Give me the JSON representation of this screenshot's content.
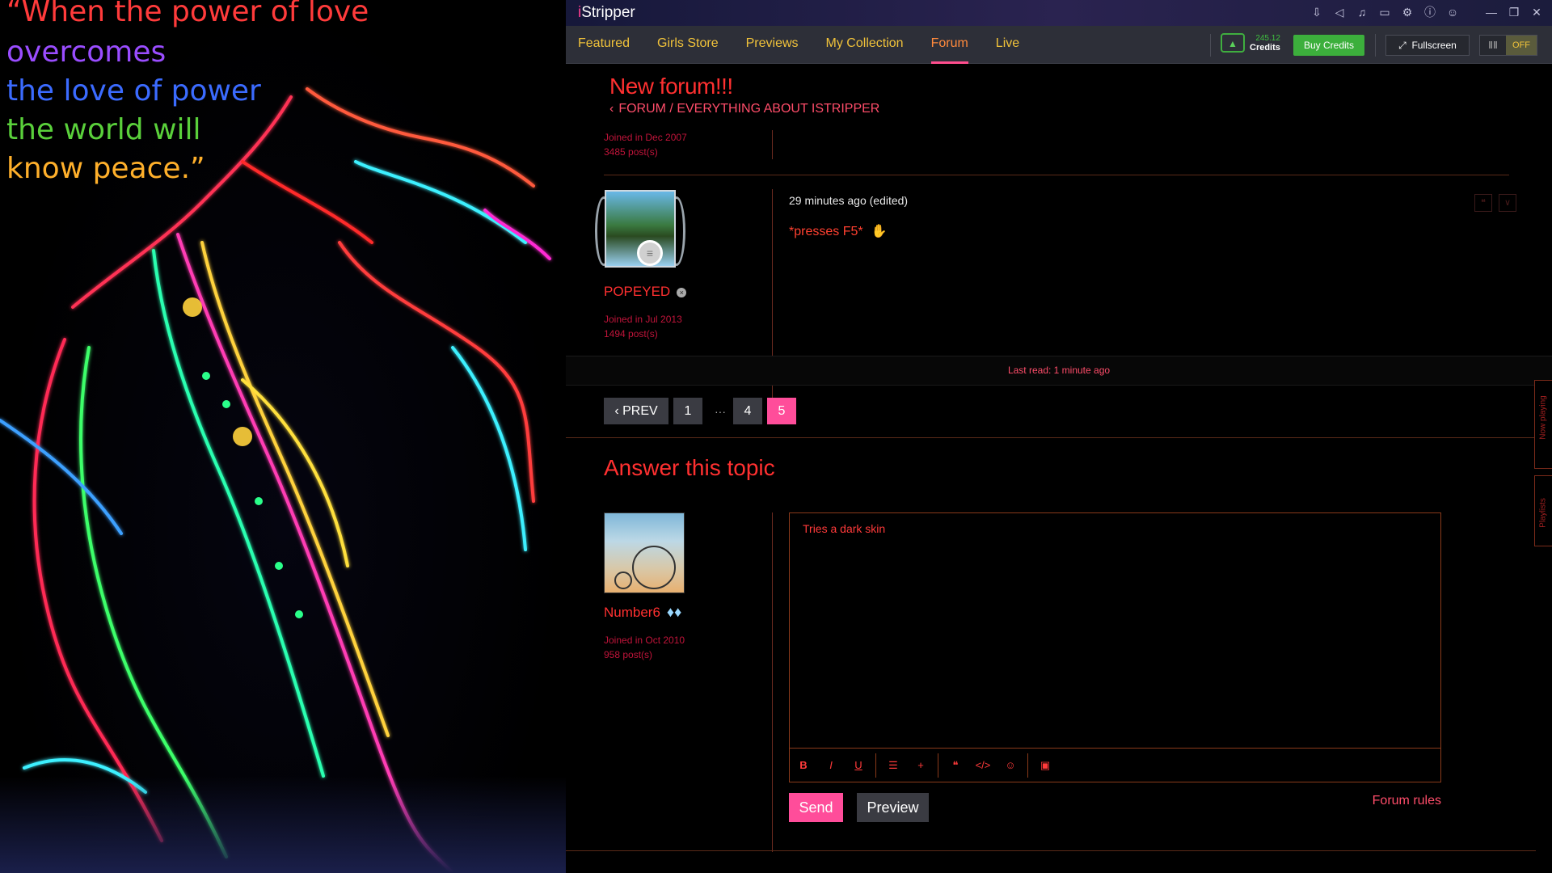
{
  "wallpaper": {
    "quote_lines": [
      {
        "text": "“When the power of love",
        "color": "#ff3b3b"
      },
      {
        "text": "overcomes",
        "color": "#9a4dff"
      },
      {
        "text": "the love of power",
        "color": "#3b6bff"
      },
      {
        "text": "the world will",
        "color": "#5ad03b"
      },
      {
        "text": "know peace.”",
        "color": "#ffb02b"
      }
    ]
  },
  "app": {
    "title_brand": "i",
    "title_rest": "Stripper",
    "window_icons": [
      "download-icon",
      "megaphone-icon",
      "music-icon",
      "monitor-icon",
      "gear-icon",
      "info-icon",
      "user-icon"
    ],
    "window_controls": [
      "minimize-icon",
      "restore-icon",
      "close-icon"
    ]
  },
  "nav": {
    "items": [
      {
        "label": "Featured"
      },
      {
        "label": "Girls Store"
      },
      {
        "label": "Previews"
      },
      {
        "label": "My Collection"
      },
      {
        "label": "Forum"
      },
      {
        "label": "Live"
      }
    ],
    "active": "Forum",
    "credits_amount": "245.12",
    "credits_label": "Credits",
    "buy_credits": "Buy Credits",
    "fullscreen": "Fullscreen",
    "toggle_state": "OFF"
  },
  "topic": {
    "title": "New forum!!!",
    "breadcrumb": "FORUM / EVERYTHING ABOUT ISTRIPPER"
  },
  "prev_post_meta": {
    "joined": "Joined in Dec 2007",
    "posts": "3485 post(s)"
  },
  "post": {
    "username": "POPEYED",
    "joined": "Joined in Jul 2013",
    "posts": "1494 post(s)",
    "time": "29 minutes ago (edited)",
    "body": "*presses F5*"
  },
  "last_read": "Last read: 1 minute ago",
  "pagination": {
    "prev": "PREV",
    "pages": [
      "1",
      "4",
      "5"
    ],
    "ellipsis": "···",
    "current": "5"
  },
  "reply": {
    "heading": "Answer this topic",
    "username": "Number6",
    "joined": "Joined in Oct 2010",
    "posts": "958 post(s)",
    "text": "Tries a dark skin",
    "toolbar": [
      "bold-icon",
      "italic-icon",
      "underline-icon",
      "list-icon",
      "plus-icon",
      "quote-icon",
      "code-icon",
      "emoji-icon",
      "image-icon"
    ],
    "send": "Send",
    "preview": "Preview",
    "forum_rules": "Forum rules"
  },
  "side_tabs": {
    "now_playing": "Now playing",
    "playlists": "Playlists"
  },
  "colors": {
    "accent_pink": "#ff4d9a",
    "nav_gold": "#f0c23a",
    "text_red": "#ff3030",
    "credits_green": "#3caf3c"
  }
}
